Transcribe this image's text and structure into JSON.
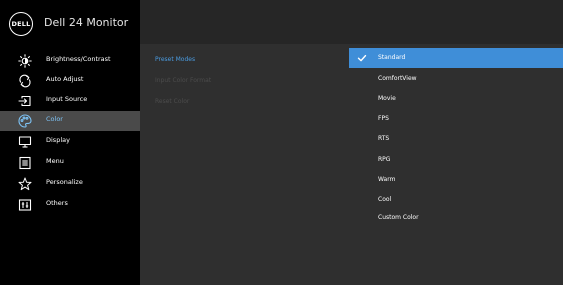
{
  "app": {
    "title": "Dell 24 Monitor",
    "logo_text": "DELL"
  },
  "main_menu": [
    {
      "label": "Brightness/Contrast",
      "icon": "brightness-icon",
      "selected": false
    },
    {
      "label": "Auto Adjust",
      "icon": "auto-adjust-icon",
      "selected": false
    },
    {
      "label": "Input Source",
      "icon": "input-source-icon",
      "selected": false
    },
    {
      "label": "Color",
      "icon": "color-palette-icon",
      "selected": true
    },
    {
      "label": "Display",
      "icon": "display-icon",
      "selected": false
    },
    {
      "label": "Menu",
      "icon": "menu-icon",
      "selected": false
    },
    {
      "label": "Personalize",
      "icon": "star-icon",
      "selected": false
    },
    {
      "label": "Others",
      "icon": "others-icon",
      "selected": false
    }
  ],
  "color_submenu": [
    {
      "label": "Preset Modes",
      "state": "active"
    },
    {
      "label": "Input Color Format",
      "state": "disabled"
    },
    {
      "label": "Reset Color",
      "state": "disabled"
    }
  ],
  "preset_modes": {
    "selected": "Standard",
    "options": [
      "Standard",
      "ComfortView",
      "Movie",
      "FPS",
      "RTS",
      "RPG",
      "Warm",
      "Cool",
      "Custom Color"
    ]
  },
  "colors": {
    "left_panel": "#000000",
    "panel": "#2f2f2f",
    "selected_menu": "#4a4a4a",
    "accent_text": "#7ec3f5",
    "selected_option": "#3f8ed8"
  }
}
